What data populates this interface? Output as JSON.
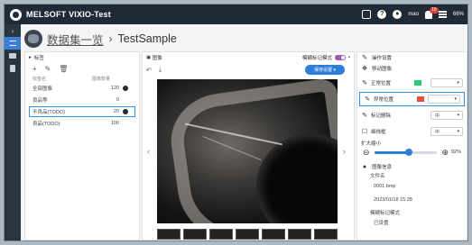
{
  "app": {
    "title": "MELSOFT VIXIO-Test",
    "user": "mao",
    "notifications": "10",
    "battery": "66%"
  },
  "breadcrumb": {
    "project": "数据集一览",
    "separator": "›",
    "current": "TestSample"
  },
  "labels_panel": {
    "title": "标签",
    "col_name": "标签名",
    "col_count": "图像数量",
    "rows": [
      {
        "name": "全部图像",
        "count": "120"
      },
      {
        "name": "良品等",
        "count": "0"
      },
      {
        "name": "不良品(TODO)",
        "count": "20"
      },
      {
        "name": "良品(TODO)",
        "count": "100"
      }
    ]
  },
  "viewer": {
    "title": "图像",
    "toggle_label": "模糊标记模式",
    "button_label": "保存设置 ▾"
  },
  "properties": {
    "title": "操作设置",
    "move_label": "移动图像",
    "rows": [
      {
        "label": "正常位置",
        "color": "#2ecc71"
      },
      {
        "label": "异常位置",
        "color": "#e74c3c"
      },
      {
        "label": "标记删除",
        "value": "中"
      },
      {
        "label": "细线框",
        "value": "中"
      }
    ],
    "zoom_label": "扩大缩小",
    "zoom_value": "92%",
    "zoom_fraction": 0.55,
    "image_info_title": "图像信息",
    "file_label": "文件名",
    "file_name": "0001.bmp",
    "date": "2023/01/18 15:28",
    "mode_label": "模糊标记模式",
    "mode_value": "已设置"
  }
}
